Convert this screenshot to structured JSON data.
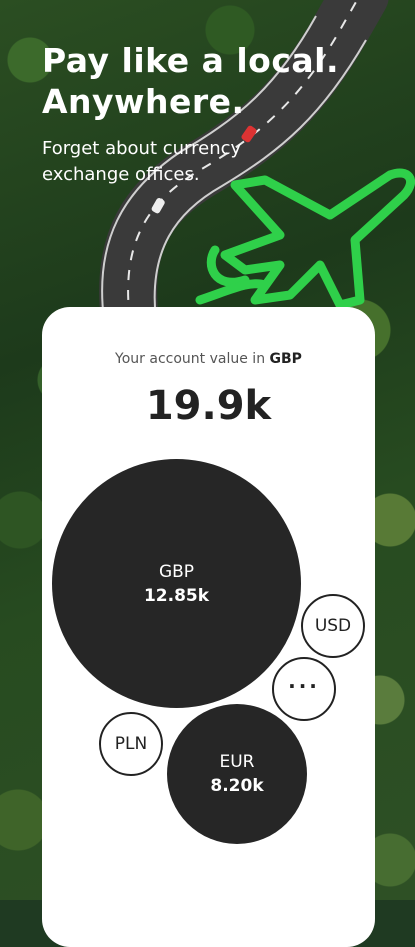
{
  "hero": {
    "headline_line1": "Pay like a local.",
    "headline_line2": "Anywhere.",
    "subline": "Forget about currency exchange offices."
  },
  "account": {
    "label_prefix": "Your account value in",
    "label_currency": "GBP",
    "value": "19.9k"
  },
  "currencies": [
    {
      "code": "GBP",
      "amount": "12.85k"
    },
    {
      "code": "USD"
    },
    {
      "code": "PLN"
    },
    {
      "code": "EUR",
      "amount": "8.20k"
    }
  ],
  "more": {
    "label": "···"
  },
  "colors": {
    "accent_green": "#2fd04a",
    "bubble_dark": "#262626",
    "card": "#ffffff"
  },
  "icons": {
    "plane": "airplane-outline-icon"
  }
}
